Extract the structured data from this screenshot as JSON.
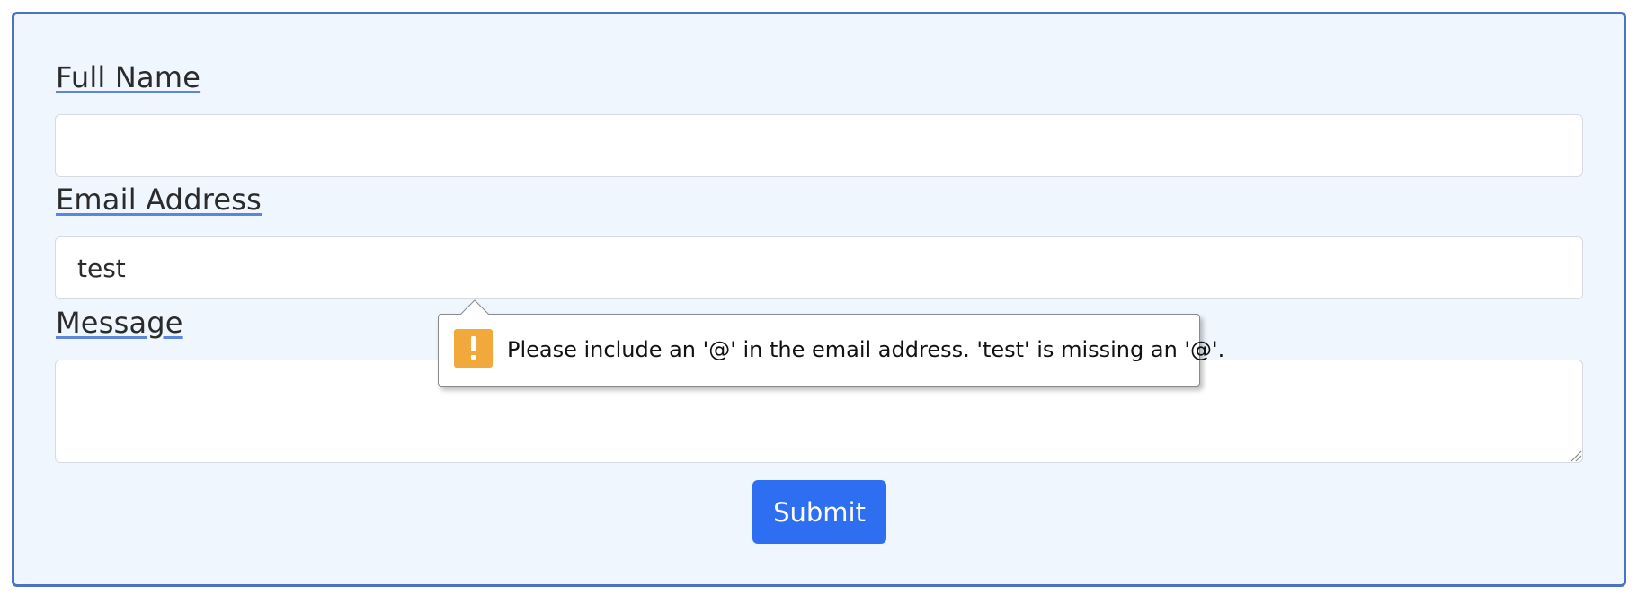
{
  "form": {
    "fields": {
      "full_name": {
        "label": "Full Name",
        "value": ""
      },
      "email": {
        "label": "Email Address",
        "value": "test"
      },
      "message": {
        "label": "Message",
        "value": ""
      }
    },
    "submit_label": "Submit"
  },
  "validation_tooltip": {
    "icon": "warning-icon",
    "message": "Please include an '@' in the email address. 'test' is missing an '@'."
  },
  "colors": {
    "card_border": "#4a74c2",
    "card_background": "#eff6fe",
    "submit_button": "#2e6ff2",
    "warning_icon": "#f2a93b",
    "label_underline": "#5b86d9"
  }
}
